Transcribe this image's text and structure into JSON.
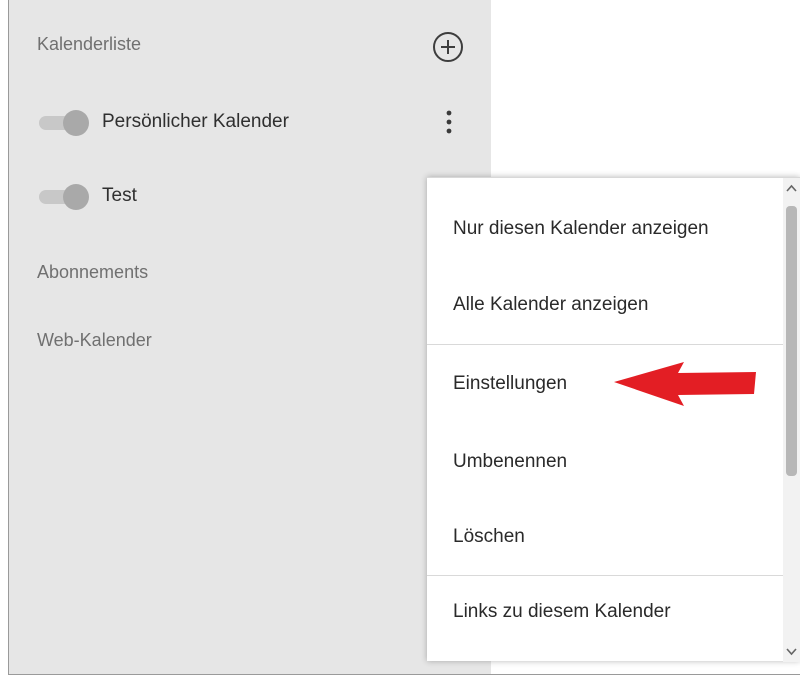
{
  "sidebar": {
    "title": "Kalenderliste",
    "add_icon": "circle-plus-icon",
    "calendars": [
      {
        "label": "Persönlicher Kalender",
        "enabled": true
      },
      {
        "label": "Test",
        "enabled": true
      }
    ],
    "more_icon": "vertical-ellipsis-icon",
    "sections": {
      "subscriptions": "Abonnements",
      "web_calendars": "Web-Kalender"
    }
  },
  "context_menu": {
    "items": [
      {
        "label": "Nur diesen Kalender anzeigen"
      },
      {
        "label": "Alle Kalender anzeigen"
      },
      {
        "label": "Einstellungen",
        "highlighted_by_arrow": true
      },
      {
        "label": "Umbenennen"
      },
      {
        "label": "Löschen"
      },
      {
        "label": "Links zu diesem Kalender"
      }
    ]
  },
  "annotation": {
    "arrow_icon": "red-arrow-left-icon",
    "arrow_color": "#e31e24"
  },
  "colors": {
    "sidebar_background": "#e6e6e6",
    "menu_background": "#ffffff",
    "toggle_knob": "#a9a9a9",
    "toggle_track": "#c8c8c8"
  }
}
